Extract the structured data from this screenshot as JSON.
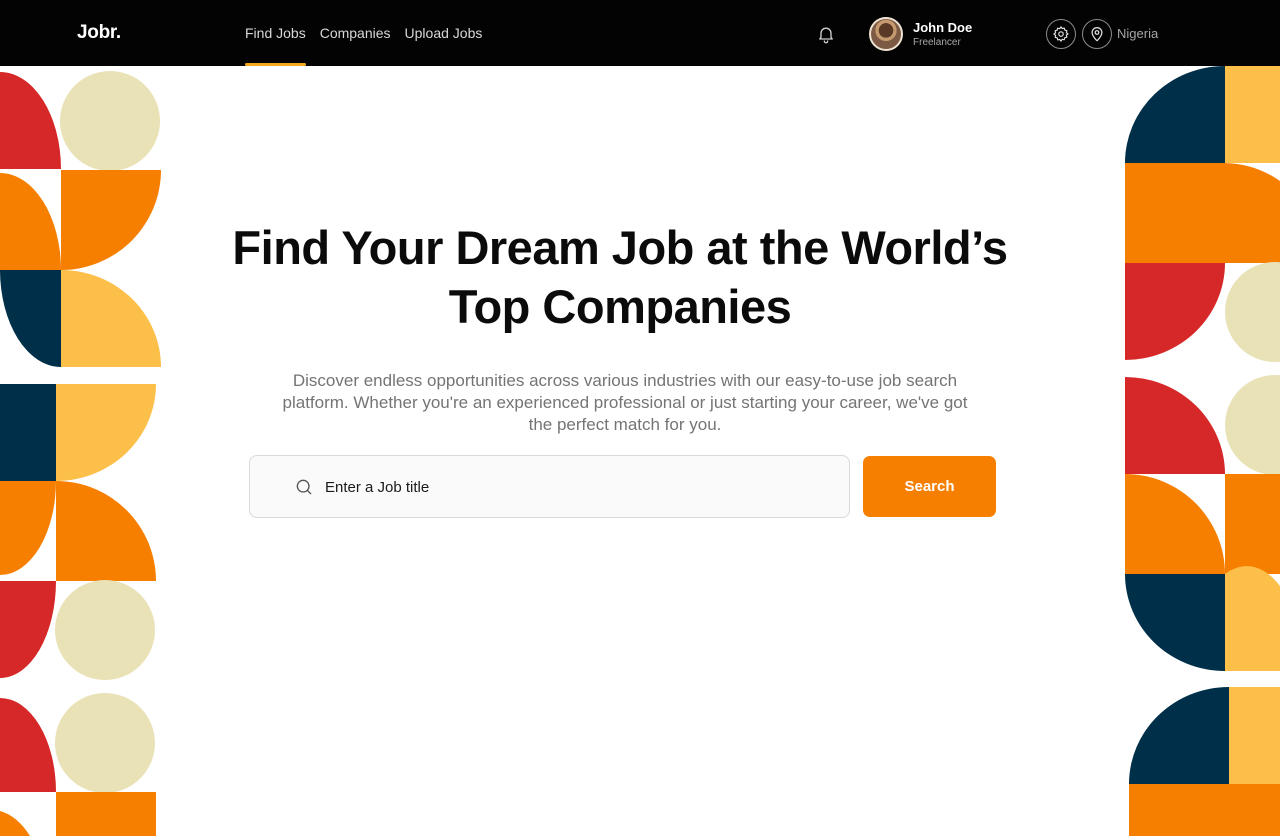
{
  "header": {
    "logo": "Jobr.",
    "nav": [
      {
        "label": "Find Jobs",
        "active": true
      },
      {
        "label": "Companies",
        "active": false
      },
      {
        "label": "Upload Jobs",
        "active": false
      }
    ],
    "user": {
      "name": "John Doe",
      "role": "Freelancer"
    },
    "location": "Nigeria",
    "icons": [
      "bell-icon",
      "gear-icon",
      "location-pin-icon"
    ]
  },
  "hero": {
    "title_line1": "Find Your Dream Job at the World’s",
    "title_line2": "Top Companies",
    "subtitle": "Discover endless opportunities across various industries with our easy-to-use job search platform. Whether you're an experienced professional or just starting your career, we've got the perfect match for you."
  },
  "search": {
    "placeholder": "Enter a Job title",
    "value": "",
    "button_label": "Search"
  },
  "theme": {
    "accent": "#f77f00",
    "nav_underline": "#f5a81c",
    "pattern_colors": [
      "#d62828",
      "#f77f00",
      "#fcbf49",
      "#eae2b7",
      "#003049"
    ]
  }
}
